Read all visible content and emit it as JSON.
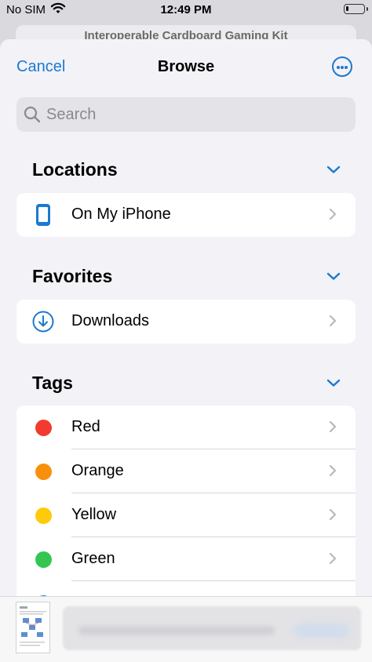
{
  "status_bar": {
    "carrier": "No SIM",
    "time": "12:49 PM"
  },
  "background_sheet": {
    "title": "Interoperable Cardboard Gaming Kit"
  },
  "nav": {
    "cancel_label": "Cancel",
    "title": "Browse",
    "more_icon": "ellipsis-circle-icon"
  },
  "search": {
    "placeholder": "Search"
  },
  "sections": {
    "locations": {
      "title": "Locations",
      "items": [
        {
          "label": "On My iPhone",
          "icon": "iphone-icon"
        }
      ]
    },
    "favorites": {
      "title": "Favorites",
      "items": [
        {
          "label": "Downloads",
          "icon": "download-circle-icon"
        }
      ]
    },
    "tags": {
      "title": "Tags",
      "items": [
        {
          "label": "Red",
          "color": "#f23a30"
        },
        {
          "label": "Orange",
          "color": "#f9900b"
        },
        {
          "label": "Yellow",
          "color": "#fecb0a"
        },
        {
          "label": "Green",
          "color": "#35c651"
        },
        {
          "label": "",
          "color": "#1c79d0"
        }
      ]
    }
  },
  "colors": {
    "accent": "#1c79d0",
    "background": "#f2f2f7"
  }
}
